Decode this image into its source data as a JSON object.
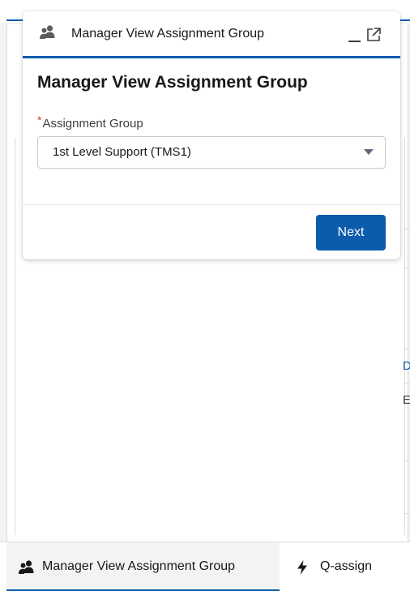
{
  "modal": {
    "header_title": "Manager View Assignment Group",
    "heading": "Manager View Assignment Group",
    "field_label": "Assignment Group",
    "required_marker": "*",
    "selected_value": "1st Level Support (TMS1)",
    "next_label": "Next",
    "icons": {
      "header": "group-icon",
      "minimize": "minimize-icon",
      "popout": "popout-icon",
      "dropdown": "caret-down-icon"
    }
  },
  "utility_bar": {
    "items": [
      {
        "label": "Manager View Assignment Group",
        "icon": "group-icon",
        "active": true
      },
      {
        "label": "Q-assign",
        "icon": "lightning-icon",
        "active": false
      }
    ]
  },
  "background": {
    "fragment_blue": "D",
    "fragment_dark": "E"
  },
  "colors": {
    "brand": "#0b5cab",
    "required": "#c23934",
    "text": "#181818"
  }
}
